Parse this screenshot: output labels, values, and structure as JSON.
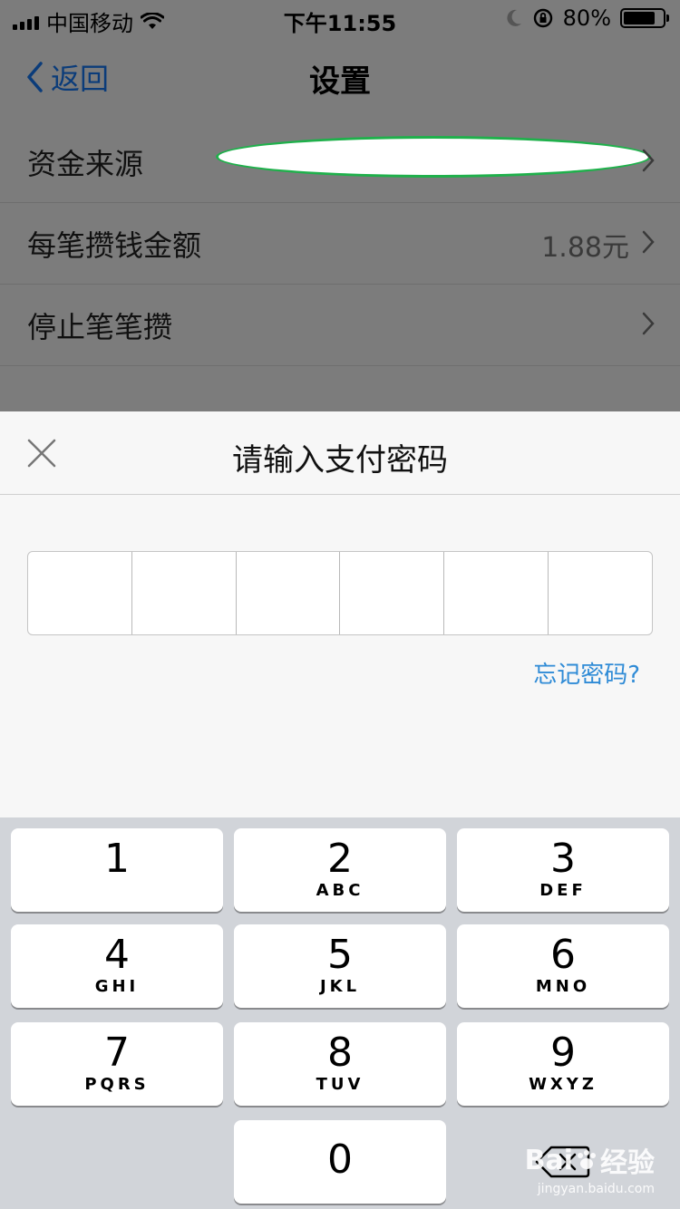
{
  "status_bar": {
    "carrier": "中国移动",
    "time": "下午11:55",
    "battery_text": "80%",
    "battery_level": 0.8,
    "icons": [
      "signal-icon",
      "wifi-icon",
      "moon-icon",
      "orientation-lock-icon",
      "battery-icon"
    ]
  },
  "nav": {
    "back_label": "返回",
    "title": "设置"
  },
  "settings": {
    "rows": [
      {
        "label": "资金来源",
        "value": ""
      },
      {
        "label": "每笔攒钱金额",
        "value": "1.88元"
      },
      {
        "label": "停止笔笔攒",
        "value": ""
      }
    ]
  },
  "payment_sheet": {
    "title": "请输入支付密码",
    "pin_length": 6,
    "forgot_label": "忘记密码?"
  },
  "keypad": {
    "keys": [
      {
        "num": "1",
        "letters": ""
      },
      {
        "num": "2",
        "letters": "ABC"
      },
      {
        "num": "3",
        "letters": "DEF"
      },
      {
        "num": "4",
        "letters": "GHI"
      },
      {
        "num": "5",
        "letters": "JKL"
      },
      {
        "num": "6",
        "letters": "MNO"
      },
      {
        "num": "7",
        "letters": "PQRS"
      },
      {
        "num": "8",
        "letters": "TUV"
      },
      {
        "num": "9",
        "letters": "WXYZ"
      },
      {
        "num": "0",
        "letters": ""
      }
    ]
  },
  "watermark": {
    "brand": "Bai",
    "brand_suffix": "经验",
    "url": "jingyan.baidu.com"
  },
  "colors": {
    "overlay_background": "#7c7c7c",
    "back_link": "#0b3c7a",
    "forgot_link": "#2f8bd6",
    "redaction_outline": "#1fb04b",
    "keypad_background": "#d1d4d9"
  }
}
